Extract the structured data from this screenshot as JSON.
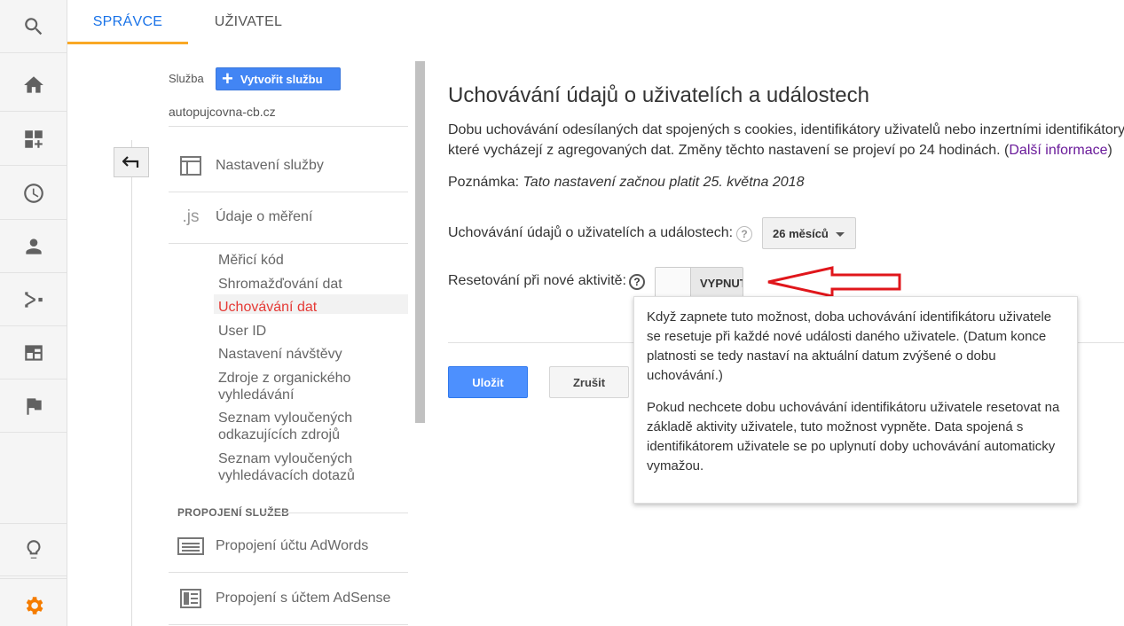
{
  "tabs": {
    "admin": "SPRÁVCE",
    "user": "UŽIVATEL"
  },
  "rail": {
    "items": [
      {
        "icon": "search-icon"
      },
      {
        "icon": "home-icon"
      },
      {
        "icon": "dashboard-add-icon"
      },
      {
        "icon": "clock-icon"
      },
      {
        "icon": "person-icon"
      },
      {
        "icon": "share-icon"
      },
      {
        "icon": "browser-icon"
      },
      {
        "icon": "flag-icon"
      },
      {
        "icon": "lightbulb-icon"
      },
      {
        "icon": "gear-icon"
      }
    ],
    "active_color": "#f57c00"
  },
  "nav": {
    "service_label": "Služba",
    "create_button": "Vytvořit službu",
    "property_name": "autopujcovna-cb.cz",
    "sections": {
      "settings": "Nastavení služby",
      "tracking_icon": ".js",
      "tracking": "Údaje o měření"
    },
    "sub_items": [
      "Měřicí kód",
      "Shromažďování dat",
      "Uchovávání dat",
      "User ID",
      "Nastavení návštěvy",
      "Zdroje z organického",
      "vyhledávání",
      "Seznam vyloučených",
      "odkazujících zdrojů",
      "Seznam vyloučených",
      "vyhledávacích dotazů"
    ],
    "links_heading": "PROPOJENÍ SLUŽEB",
    "links": {
      "adwords": "Propojení účtu AdWords",
      "adsense": "Propojení s účtem AdSense"
    }
  },
  "main": {
    "title": "Uchovávání údajů o uživatelích a událostech",
    "description_line1": "Dobu uchovávání odesílaných dat spojených s cookies, identifikátory uživatelů nebo inzertními identifikátory",
    "description_line2": "které vycházejí z agregovaných dat. Změny těchto nastavení se projeví po 24 hodinách. (",
    "learn_more": "Další informace",
    "description_end": ")",
    "note_label": "Poznámka:",
    "note_text": "Tato nastavení začnou platit 25. května 2018",
    "retention_label": "Uchovávání údajů o uživatelích a událostech:",
    "retention_value": "26 měsíců",
    "reset_label": "Resetování při nové aktivitě:",
    "reset_toggle": "VYPNUTO",
    "help": "?",
    "save": "Uložit",
    "cancel": "Zrušit"
  },
  "tooltip": {
    "para1": "Když zapnete tuto možnost, doba uchovávání identifikátoru uživatele se resetuje při každé nové události daného uživatele. (Datum konce platnosti se tedy nastaví na aktuální datum zvýšené o dobu uchovávání.)",
    "para2": "Pokud nechcete dobu uchovávání identifikátoru uživatele resetovat na základě aktivity uživatele, tuto možnost vypněte. Data spojená s identifikátorem uživatele se po uplynutí doby uchovávání automaticky vymažou."
  },
  "colors": {
    "accent_blue": "#4285f4",
    "tab_blue": "#1a73e8",
    "tab_underline": "#f9a825",
    "active_nav": "#e53935",
    "annotation_arrow": "#e0161b"
  }
}
